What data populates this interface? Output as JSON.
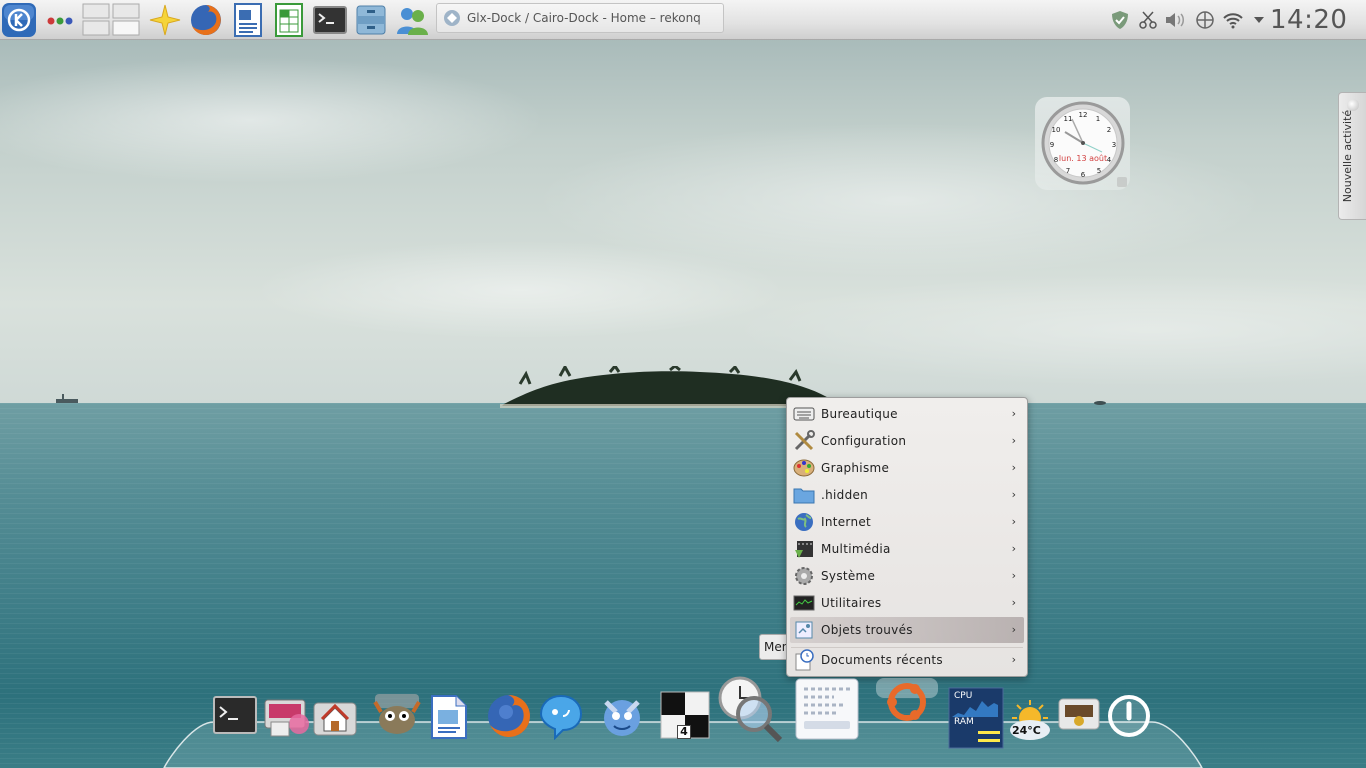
{
  "top_panel": {
    "launchers": [
      {
        "name": "kde-menu-icon"
      },
      {
        "name": "activities-dots-icon"
      },
      {
        "name": "pager-icon"
      },
      {
        "name": "favorites-star-icon"
      },
      {
        "name": "firefox-icon"
      },
      {
        "name": "writer-icon"
      },
      {
        "name": "calc-icon"
      },
      {
        "name": "terminal-icon"
      },
      {
        "name": "file-cabinet-icon"
      },
      {
        "name": "users-icon"
      }
    ],
    "task": {
      "title": "Glx-Dock / Cairo-Dock - Home – rekonq",
      "icon": "rekonq-icon"
    },
    "tray_icons": [
      "shield-icon",
      "scissors-icon",
      "volume-icon",
      "network-icon",
      "wifi-icon",
      "chevron-down-icon"
    ],
    "clock": "14:20"
  },
  "activity_tab": {
    "label": "Nouvelle activité"
  },
  "clock_widget": {
    "date_label": "lun. 13 août",
    "numbers": [
      "12",
      "1",
      "2",
      "3",
      "4",
      "5",
      "6",
      "7",
      "8",
      "9",
      "10",
      "11"
    ]
  },
  "menu": {
    "items": [
      {
        "label": "Bureautique",
        "icon": "keyboard-icon"
      },
      {
        "label": "Configuration",
        "icon": "tools-icon"
      },
      {
        "label": "Graphisme",
        "icon": "palette-icon"
      },
      {
        "label": ".hidden",
        "icon": "folder-icon"
      },
      {
        "label": "Internet",
        "icon": "globe-icon"
      },
      {
        "label": "Multimédia",
        "icon": "film-icon"
      },
      {
        "label": "Système",
        "icon": "gear-icon"
      },
      {
        "label": "Utilitaires",
        "icon": "monitor-icon"
      },
      {
        "label": "Objets trouvés",
        "icon": "lost-found-icon"
      },
      {
        "label": "Documents récents",
        "icon": "recent-docs-icon"
      }
    ],
    "highlighted_index": 8,
    "arrow": "›",
    "tooltip": "Menu"
  },
  "dock": {
    "items": [
      {
        "name": "terminal-dock-icon"
      },
      {
        "name": "software-center-icon"
      },
      {
        "name": "home-folder-icon"
      },
      {
        "name": "gimp-icon"
      },
      {
        "name": "document-viewer-icon"
      },
      {
        "name": "firefox-dock-icon"
      },
      {
        "name": "pidgin-icon"
      },
      {
        "name": "kde-dragon-icon"
      },
      {
        "name": "switcher-icon",
        "label": "4"
      },
      {
        "name": "clock-search-icon"
      },
      {
        "name": "system-monitor-icon"
      },
      {
        "name": "ubuntu-icon"
      },
      {
        "name": "cpu-ram-monitor-icon",
        "labels": [
          "CPU",
          "RAM"
        ]
      },
      {
        "name": "weather-icon",
        "label": "24°C"
      },
      {
        "name": "recycle-bin-icon"
      },
      {
        "name": "power-icon"
      }
    ]
  }
}
